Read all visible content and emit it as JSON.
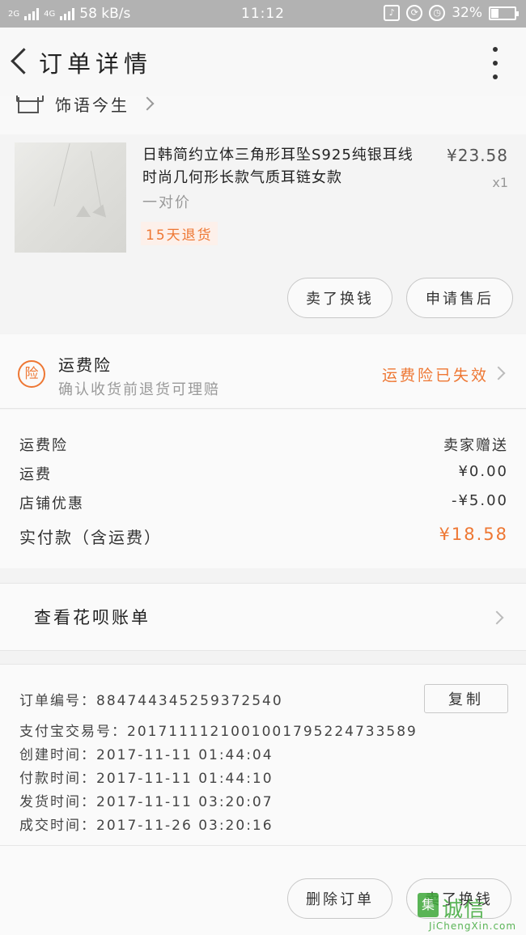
{
  "status_bar": {
    "network_left": "2G",
    "network_right": "4G",
    "speed": "58 kB/s",
    "time": "11:12",
    "battery": "32%"
  },
  "header": {
    "title": "订单详情"
  },
  "store": {
    "name": "饰语今生"
  },
  "product": {
    "title": "日韩简约立体三角形耳坠S925纯银耳线时尚几何形长款气质耳链女款",
    "spec": "一对价",
    "tag": "15天退货",
    "price": "¥23.58",
    "qty": "x1",
    "btn_sell": "卖了换钱",
    "btn_after_sale": "申请售后"
  },
  "insurance": {
    "badge": "险",
    "name": "运费险",
    "desc": "确认收货前退货可理赔",
    "status": "运费险已失效"
  },
  "fees": {
    "rows": [
      {
        "label": "运费险",
        "value": "卖家赠送"
      },
      {
        "label": "运费",
        "value": "¥0.00"
      },
      {
        "label": "店铺优惠",
        "value": "-¥5.00"
      }
    ],
    "total_label": "实付款（含运费）",
    "total_value": "¥18.58"
  },
  "huabei": {
    "label": "查看花呗账单"
  },
  "order_info": {
    "order_no_label": "订单编号：",
    "order_no": "884744345259372540",
    "copy_label": "复制",
    "alipay_label": "支付宝交易号：",
    "alipay_no": "2017111121001001795224733589",
    "created_label": "创建时间：",
    "created": "2017-11-11 01:44:04",
    "paid_label": "付款时间：",
    "paid": "2017-11-11 01:44:10",
    "shipped_label": "发货时间：",
    "shipped": "2017-11-11 03:20:07",
    "closed_label": "成交时间：",
    "closed": "2017-11-26 03:20:16"
  },
  "footer": {
    "btn_delete": "删除订单",
    "btn_sell": "卖了换钱"
  },
  "watermark": {
    "logo": "集",
    "text": "诚信",
    "sub": "JiChengXin.com"
  },
  "colors": {
    "accent": "#ee7733",
    "status_bar": "#b2b2b2"
  }
}
